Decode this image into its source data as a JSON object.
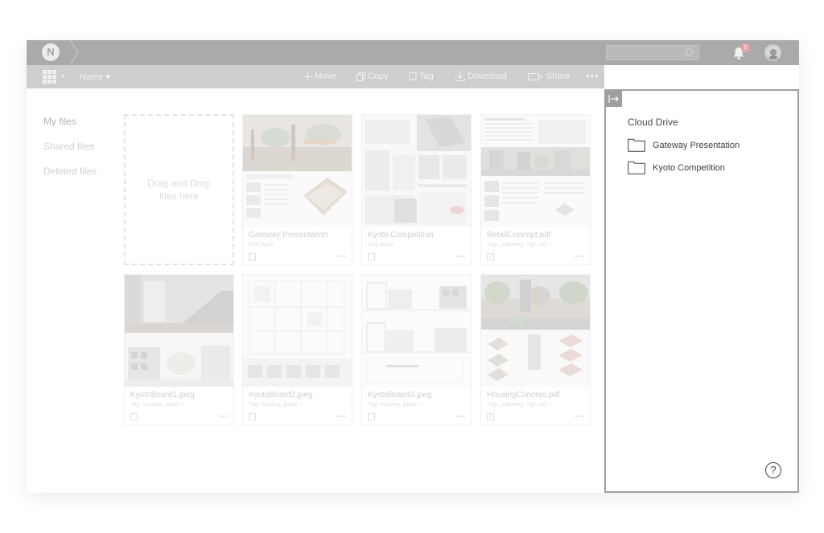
{
  "app": {
    "logo_letter": "N"
  },
  "header": {
    "search": {
      "placeholder": ""
    },
    "notifications": {
      "badge": "2"
    }
  },
  "toolbar": {
    "sort_label": "Name",
    "actions": {
      "move": "Move",
      "copy": "Copy",
      "tag": "Tag",
      "download": "Download",
      "share": "Share",
      "more": "•••"
    }
  },
  "nav": {
    "items": [
      {
        "label": "My files",
        "active": true
      },
      {
        "label": "Shared files",
        "active": false
      },
      {
        "label": "Deleted files",
        "active": false
      }
    ]
  },
  "dropzone": {
    "label": "Drag and Drop files here"
  },
  "files": [
    {
      "title": "Gateway Presentation",
      "tags": "Add tag(s)",
      "checked": false,
      "thumb": "gateway"
    },
    {
      "title": "Kyoto Competition",
      "tags": "Add tag(s)",
      "checked": false,
      "thumb": "kyoto"
    },
    {
      "title": "RetailConcept.pdf",
      "tags": "Tags: planning, high rise +",
      "checked": true,
      "thumb": "retail"
    },
    {
      "title": "KyotoBoard1.jpeg",
      "tags": "Tag: housing, japan +",
      "checked": false,
      "thumb": "board1"
    },
    {
      "title": "KyotoBoard2.jpeg",
      "tags": "Tag: housing, japan +",
      "checked": false,
      "thumb": "board2"
    },
    {
      "title": "KyotoBoard3.jpeg",
      "tags": "Tag: housing, japan +",
      "checked": false,
      "thumb": "board3"
    },
    {
      "title": "HousingConcept.pdf",
      "tags": "Tags: planning, high rise +",
      "checked": true,
      "thumb": "housing"
    }
  ],
  "card_more_label": "•••",
  "panel": {
    "title": "Cloud Drive",
    "folders": [
      {
        "name": "Gateway Presentation"
      },
      {
        "name": "Kyoto Competition"
      }
    ],
    "help_label": "?"
  },
  "colors": {
    "topbar": "#aaaaaa",
    "toolbar": "#cecece",
    "panel_border": "#a0a0a0",
    "badge": "#e8a2a2"
  }
}
